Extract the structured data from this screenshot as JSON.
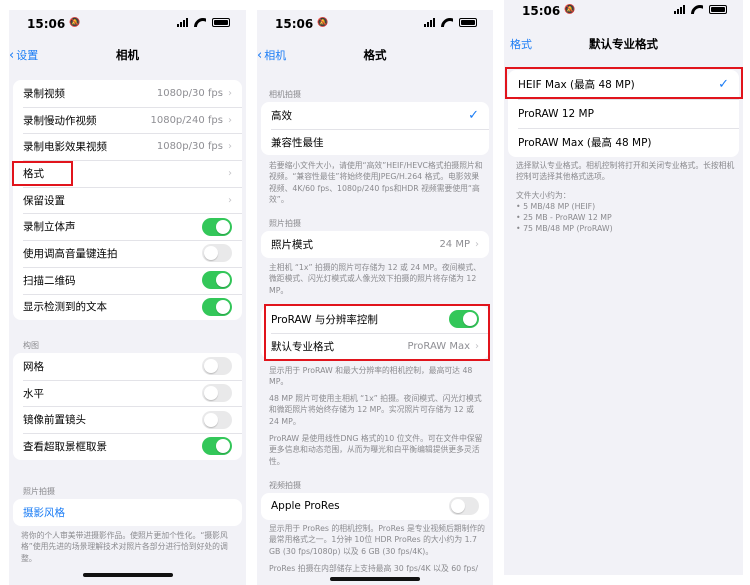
{
  "status": {
    "time": "15:06"
  },
  "p1": {
    "back": "设置",
    "title": "相机",
    "rows": [
      {
        "label": "录制视频",
        "value": "1080p/30 fps"
      },
      {
        "label": "录制慢动作视频",
        "value": "1080p/240 fps"
      },
      {
        "label": "录制电影效果视频",
        "value": "1080p/30 fps"
      },
      {
        "label": "格式",
        "value": ""
      },
      {
        "label": "保留设置",
        "value": ""
      },
      {
        "label": "录制立体声"
      },
      {
        "label": "使用调高音量键连拍"
      },
      {
        "label": "扫描二维码"
      },
      {
        "label": "显示检测到的文本"
      }
    ],
    "composition_header": "构图",
    "comp_rows": [
      {
        "label": "网格"
      },
      {
        "label": "水平"
      },
      {
        "label": "镜像前置镜头"
      },
      {
        "label": "查看超取景框取景"
      }
    ],
    "photo_header": "照片拍摄",
    "photo_style": "摄影风格",
    "photo_note": "将你的个人审美带进摄影作品。使照片更加个性化。“摄影风格”使用先进的场景理解技术对照片各部分进行恰到好处的调整。"
  },
  "p2": {
    "back": "相机",
    "title": "格式",
    "capture_header": "相机拍摄",
    "capture_rows": [
      {
        "label": "高效"
      },
      {
        "label": "兼容性最佳"
      }
    ],
    "capture_note": "若要缩小文件大小，请使用“高效”HEIF/HEVC格式拍摄照片和视频。“兼容性最佳”将始终使用JPEG/H.264 格式。电影效果视频、4K/60 fps、1080p/240 fps和HDR 视频需要使用“高效”。",
    "photo_header": "照片拍摄",
    "photo_mode_label": "照片模式",
    "photo_mode_value": "24 MP",
    "photo_note": "主相机 “1x” 拍摄的照片可存储为 12 或 24 MP。夜间模式、微距模式、闪光灯模式或人像光效下拍摄的照片将存储为 12 MP。",
    "proraw_label": "ProRAW 与分辨率控制",
    "pro_format_label": "默认专业格式",
    "pro_format_value": "ProRAW Max",
    "proraw_note1": "显示用于 ProRAW 和最大分辨率的相机控制，最高可达 48 MP。",
    "proraw_note2": "48 MP 照片可使用主相机 “1x” 拍摄。夜间模式、闪光灯模式和微距照片将始终存储为 12 MP。实况照片可存储为 12 或 24 MP。",
    "proraw_note3": "ProRAW 是使用线性DNG 格式的10 位文件。可在文件中保留更多信息和动态范围，从而为曝光和白平衡编辑提供更多灵活性。",
    "video_header": "视频拍摄",
    "prores_label": "Apple ProRes",
    "prores_note": "显示用于 ProRes 的相机控制。ProRes 是专业视频后期制作的最常用格式之一。1分钟 10位 HDR ProRes 的大小约为 1.7 GB (30 fps/1080p) 以及 6 GB (30 fps/4K)。",
    "prores_note2": "ProRes 拍摄在内部储存上支持最高 30 fps/4K 以及 60 fps/"
  },
  "p3": {
    "back": "格式",
    "title": "默认专业格式",
    "options": [
      {
        "label": "HEIF Max (最高 48 MP)"
      },
      {
        "label": "ProRAW 12 MP"
      },
      {
        "label": "ProRAW Max (最高 48 MP)"
      }
    ],
    "note": "选择默认专业格式。相机控制将打开和关闭专业格式。长按相机控制可选择其他格式选项。",
    "size_header": "文件大小约为：",
    "sizes": [
      "• 5 MB/48 MP (HEIF)",
      "• 25 MB - ProRAW 12 MP",
      "• 75 MB/48 MP (ProRAW)"
    ]
  },
  "toggles": {
    "stereo": true,
    "burst": false,
    "qr": true,
    "text": true,
    "grid": false,
    "level": false,
    "mirror": false,
    "outside": true,
    "proraw": true,
    "prores": false
  },
  "colors": {
    "accent": "#1a7cf5",
    "toggle_on": "#33c759",
    "highlight": "#e1141c"
  }
}
